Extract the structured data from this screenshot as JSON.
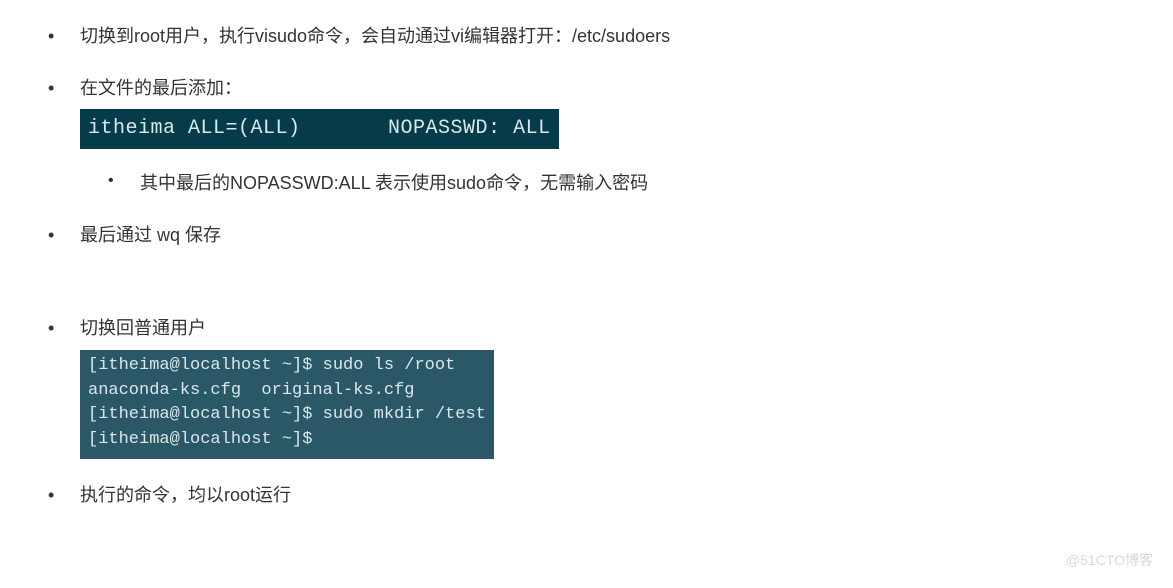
{
  "bullets": {
    "b1": "切换到root用户，执行visudo命令，会自动通过vi编辑器打开：/etc/sudoers",
    "b2": "在文件的最后添加：",
    "b2_code": "itheima ALL=(ALL)       NOPASSWD: ALL",
    "b2_sub": "其中最后的NOPASSWD:ALL 表示使用sudo命令，无需输入密码",
    "b3": "最后通过 wq 保存",
    "b4": "切换回普通用户",
    "b4_code": "[itheima@localhost ~]$ sudo ls /root\nanaconda-ks.cfg  original-ks.cfg\n[itheima@localhost ~]$ sudo mkdir /test\n[itheima@localhost ~]$",
    "b5": "执行的命令，均以root运行"
  },
  "watermark": "@51CTO博客"
}
